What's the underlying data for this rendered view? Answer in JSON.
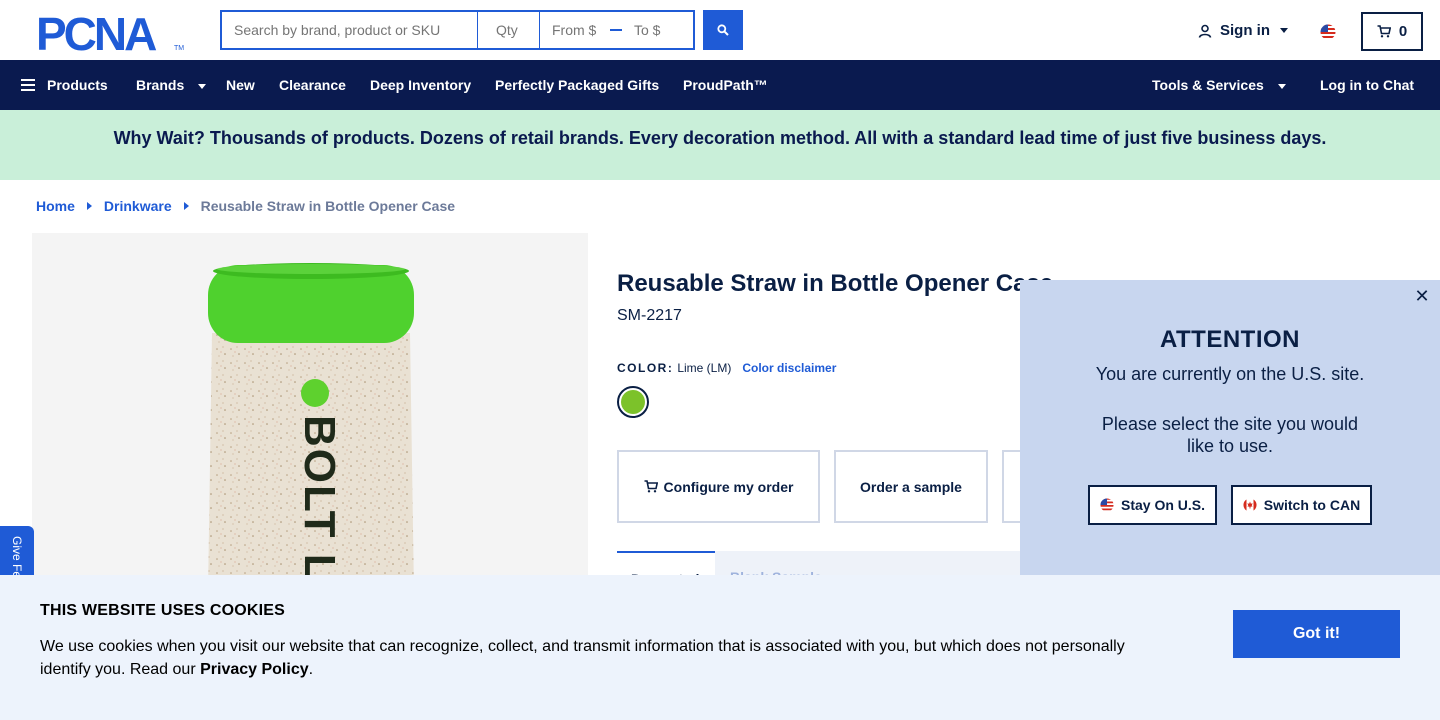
{
  "header": {
    "logo_text": "PCNA",
    "search_placeholder": "Search by brand, product or SKU",
    "qty_placeholder": "Qty",
    "price_from_placeholder": "From $",
    "price_to_placeholder": "To $",
    "signin_label": "Sign in",
    "cart_count": "0"
  },
  "nav": {
    "products": "Products",
    "brands": "Brands",
    "new": "New",
    "clearance": "Clearance",
    "deep_inventory": "Deep Inventory",
    "gifts": "Perfectly Packaged Gifts",
    "proudpath": "ProudPath™",
    "tools": "Tools & Services",
    "chat": "Log in to Chat"
  },
  "promo": {
    "text": "Why Wait? Thousands of products. Dozens of retail brands. Every decoration method. All with a standard lead time of just five business days."
  },
  "breadcrumb": {
    "home": "Home",
    "category": "Drinkware",
    "current": "Reusable Straw in Bottle Opener Case"
  },
  "product": {
    "title": "Reusable Straw in Bottle Opener Case",
    "sku": "SM-2217",
    "color_label": "COLOR:",
    "color_value": "Lime (LM)",
    "color_disclaimer": "Color disclaimer",
    "swatch_color": "#7cc22a",
    "image_text": "BOLT L"
  },
  "actions": {
    "configure": "Configure my order",
    "sample": "Order a sample"
  },
  "tabs": {
    "active": "Decorated",
    "other": "Blank Sample"
  },
  "feedback": {
    "label": "Give Feedback"
  },
  "modal": {
    "title": "ATTENTION",
    "line1": "You are currently on the U.S. site.",
    "line2": "Please select the site you would like to use.",
    "stay_label": "Stay On U.S.",
    "switch_label": "Switch to CAN",
    "close_glyph": "✕"
  },
  "cookie": {
    "title": "THIS WEBSITE USES COOKIES",
    "text": "We use cookies when you visit our website that can recognize, collect, and transmit information that is associated with you, but which does not personally identify you. Read our ",
    "link": "Privacy Policy",
    "period": ".",
    "button": "Got it!"
  },
  "colors": {
    "brand_blue": "#1f5bd6",
    "navy": "#0a1a4f",
    "promo_green": "#c9efd9",
    "modal_bg": "#c8d6ef",
    "cookie_bg": "#edf3fc"
  }
}
